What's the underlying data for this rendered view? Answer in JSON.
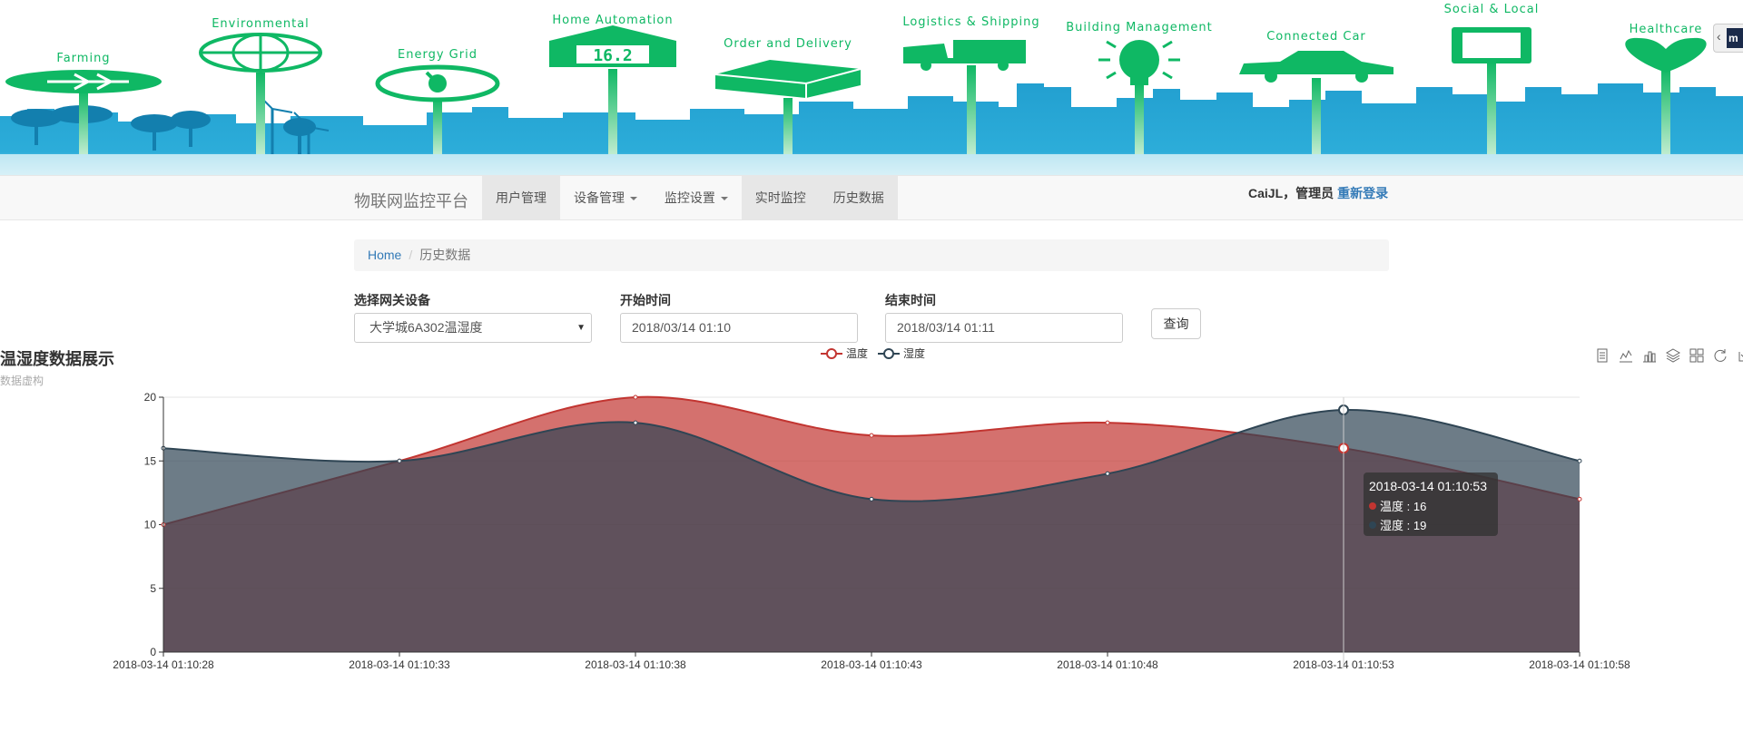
{
  "banner": {
    "labels": [
      "Farming",
      "Environmental",
      "Energy Grid",
      "Home Automation",
      "Order and Delivery",
      "Logistics & Shipping",
      "Building Management",
      "Connected Car",
      "Social & Local",
      "Healthcare"
    ],
    "display_value": "16.2",
    "ext_label": "m",
    "icons": [
      "leaf-icon",
      "globe-icon",
      "gauge-icon",
      "house-icon",
      "package-icon",
      "truck-icon",
      "lightbulb-icon",
      "car-icon",
      "tablet-icon",
      "heart-icon"
    ]
  },
  "navbar": {
    "brand": "物联网监控平台",
    "items": [
      {
        "label": "用户管理",
        "dropdown": false
      },
      {
        "label": "设备管理",
        "dropdown": true
      },
      {
        "label": "监控设置",
        "dropdown": true
      },
      {
        "label": "实时监控",
        "dropdown": false
      },
      {
        "label": "历史数据",
        "dropdown": false
      }
    ],
    "user_text": "CaiJL，管理员",
    "relogin": "重新登录"
  },
  "breadcrumb": {
    "home": "Home",
    "separator": "/",
    "current": "历史数据"
  },
  "filters": {
    "device_label": "选择网关设备",
    "device_value": "大学城6A302温湿度",
    "start_label": "开始时间",
    "start_value": "2018/03/14 01:10",
    "end_label": "结束时间",
    "end_value": "2018/03/14 01:11",
    "query_button": "查询"
  },
  "chart_title": "温湿度数据展示",
  "chart_subtitle": "数据虚构",
  "toolbox_icons": [
    "data-view-icon",
    "line-icon",
    "bar-icon",
    "stack-icon",
    "tiled-icon",
    "restore-icon",
    "save-icon"
  ],
  "chart_data": {
    "type": "area",
    "categories": [
      "2018-03-14 01:10:28",
      "2018-03-14 01:10:33",
      "2018-03-14 01:10:38",
      "2018-03-14 01:10:43",
      "2018-03-14 01:10:48",
      "2018-03-14 01:10:53",
      "2018-03-14 01:10:58"
    ],
    "series": [
      {
        "name": "温度",
        "color": "#c23531",
        "values": [
          10,
          15,
          20,
          17,
          18,
          16,
          12
        ]
      },
      {
        "name": "湿度",
        "color": "#2f4554",
        "values": [
          16,
          15,
          18,
          12,
          14,
          19,
          15
        ]
      }
    ],
    "ylim": [
      0,
      20
    ],
    "yticks": [
      0,
      5,
      10,
      15,
      20
    ],
    "legend": "top-center",
    "grid": true,
    "tooltip": {
      "index": 5,
      "title": "2018-03-14 01:10:53",
      "rows": [
        "温度 : 16",
        "湿度 : 19"
      ]
    }
  },
  "colors": {
    "temp": "#c23531",
    "humid": "#2f4554",
    "banner_green": "#0fb864",
    "banner_blue": "#1a9cd0"
  }
}
